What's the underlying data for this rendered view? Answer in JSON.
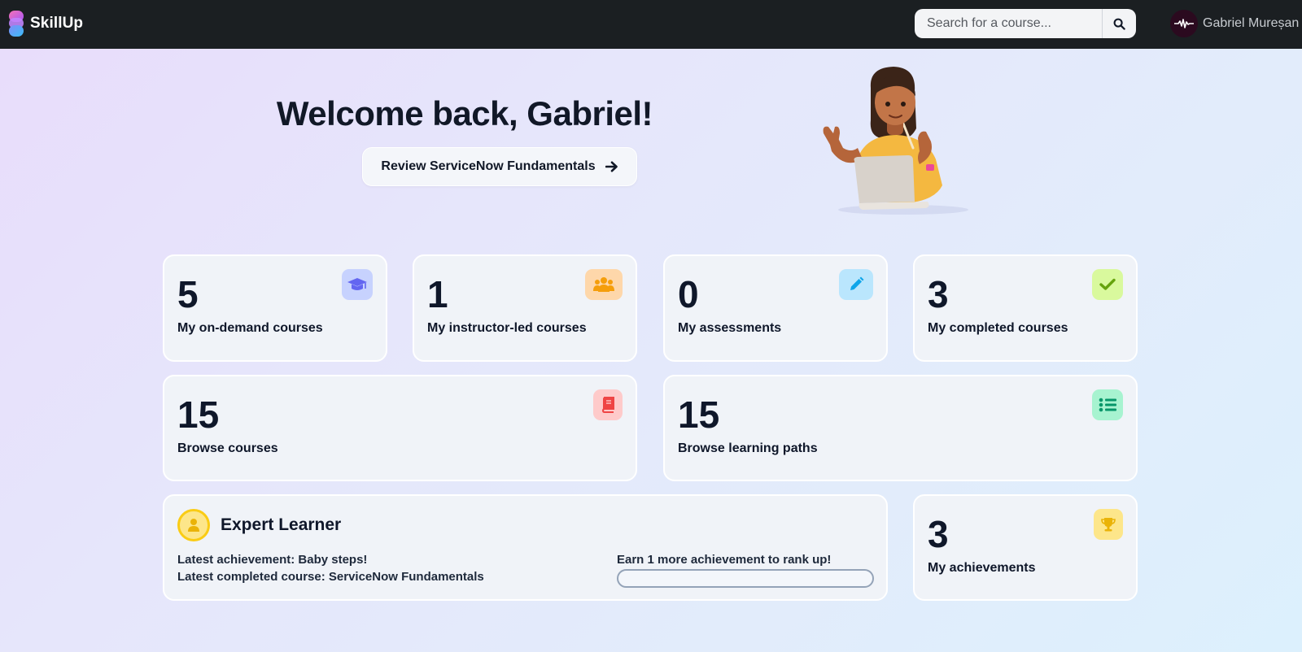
{
  "app": {
    "name": "SkillUp"
  },
  "search": {
    "placeholder": "Search for a course..."
  },
  "user": {
    "name": "Gabriel Mureșan"
  },
  "hero": {
    "title": "Welcome back, Gabriel!",
    "review_button": "Review ServiceNow Fundamentals"
  },
  "stats": [
    {
      "value": "5",
      "label": "My on-demand courses",
      "icon": "graduation-cap-icon",
      "icon_bg": "#c7d2fe",
      "icon_color": "#6366f1"
    },
    {
      "value": "1",
      "label": "My instructor-led courses",
      "icon": "users-icon",
      "icon_bg": "#fed7aa",
      "icon_color": "#f59e0b"
    },
    {
      "value": "0",
      "label": "My assessments",
      "icon": "pencil-icon",
      "icon_bg": "#bae6fd",
      "icon_color": "#0ea5e9"
    },
    {
      "value": "3",
      "label": "My completed courses",
      "icon": "check-icon",
      "icon_bg": "#d9f99d",
      "icon_color": "#65a30d"
    },
    {
      "value": "15",
      "label": "Browse courses",
      "icon": "book-icon",
      "icon_bg": "#fecaca",
      "icon_color": "#ef4444"
    },
    {
      "value": "15",
      "label": "Browse learning paths",
      "icon": "list-icon",
      "icon_bg": "#a7f3d0",
      "icon_color": "#059669"
    }
  ],
  "rank": {
    "title": "Expert Learner",
    "latest_achievement": "Latest achievement: Baby steps!",
    "latest_course": "Latest completed course: ServiceNow Fundamentals",
    "rankup_text": "Earn 1 more achievement to rank up!",
    "progress_fraction": 0
  },
  "achievements": {
    "value": "3",
    "label": "My achievements",
    "icon": "trophy-icon",
    "icon_bg": "#fde68a",
    "icon_color": "#eab308"
  }
}
